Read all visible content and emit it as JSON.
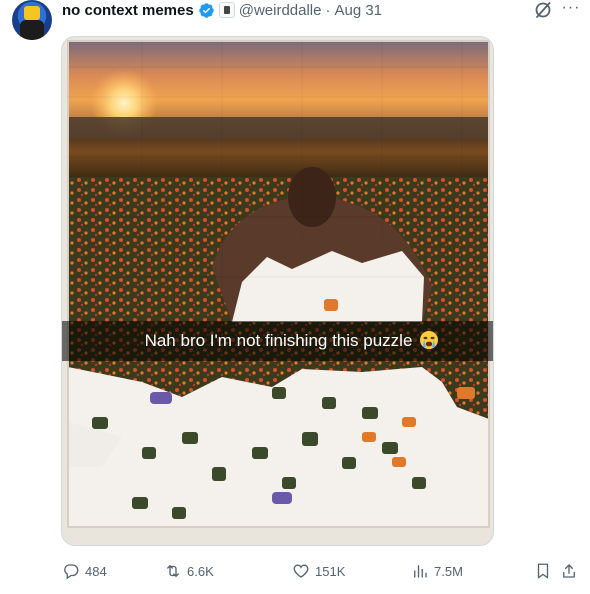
{
  "tweet": {
    "display_name": "no context memes",
    "handle": "@weirddalle",
    "separator": "·",
    "date": "Aug 31",
    "more_label": "···"
  },
  "media": {
    "caption": "Nah bro I'm not finishing this puzzle",
    "caption_emoji": "crying-face-emoji"
  },
  "actions": {
    "replies": "484",
    "reposts": "6.6K",
    "likes": "151K",
    "views": "7.5M"
  },
  "icons": {
    "verified": "verified-badge-icon",
    "affiliate": "affiliate-badge-icon",
    "grok": "grok-icon",
    "reply": "reply-icon",
    "repost": "repost-icon",
    "like": "heart-icon",
    "views": "views-chart-icon",
    "bookmark": "bookmark-icon",
    "share": "share-icon"
  },
  "colors": {
    "verified_blue": "#1d9bf0",
    "muted_text": "#536471",
    "primary_text": "#0f1419"
  }
}
